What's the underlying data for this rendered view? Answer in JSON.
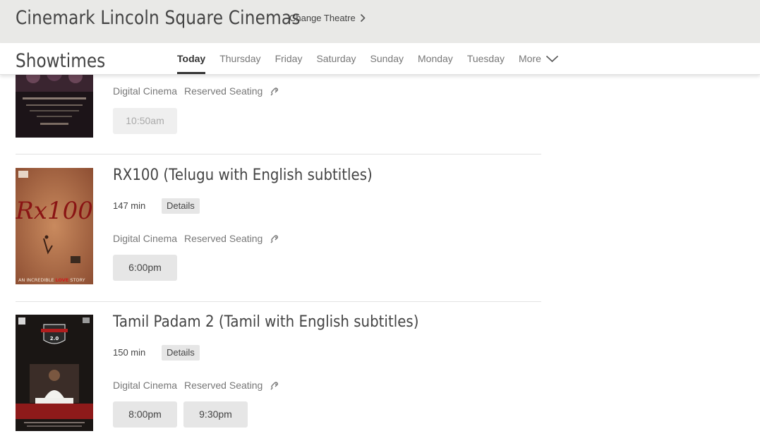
{
  "header": {
    "theatre_name": "Cinemark Lincoln Square Cinemas",
    "change_theatre_label": "Change Theatre"
  },
  "nav": {
    "title": "Showtimes",
    "tabs": [
      {
        "label": "Today",
        "active": true
      },
      {
        "label": "Thursday",
        "active": false
      },
      {
        "label": "Friday",
        "active": false
      },
      {
        "label": "Saturday",
        "active": false
      },
      {
        "label": "Sunday",
        "active": false
      },
      {
        "label": "Monday",
        "active": false
      },
      {
        "label": "Tuesday",
        "active": false
      }
    ],
    "more_label": "More"
  },
  "movies": [
    {
      "amenities": [
        "Digital Cinema",
        "Reserved Seating"
      ],
      "showtimes": [
        {
          "time": "10:50am",
          "past": true
        }
      ]
    },
    {
      "title": "RX100 (Telugu with English subtitles)",
      "runtime": "147 min",
      "details_label": "Details",
      "poster_text": {
        "logo": "Rx100",
        "tagline_1": "AN INCREDIBLE",
        "tagline_2": "LOVE",
        "tagline_3": "STORY"
      },
      "amenities": [
        "Digital Cinema",
        "Reserved Seating"
      ],
      "showtimes": [
        {
          "time": "6:00pm",
          "past": false
        }
      ]
    },
    {
      "title": "Tamil Padam 2 (Tamil with English subtitles)",
      "runtime": "150 min",
      "details_label": "Details",
      "poster_text": {
        "logo": "2.0"
      },
      "amenities": [
        "Digital Cinema",
        "Reserved Seating"
      ],
      "showtimes": [
        {
          "time": "8:00pm",
          "past": false
        },
        {
          "time": "9:30pm",
          "past": false
        }
      ]
    }
  ],
  "colors": {
    "header_bg": "#e9e9e7",
    "text": "#444444",
    "muted_text": "#777777",
    "button_bg": "#e6e6e6",
    "rx100_poster": "#b9714a",
    "tamil_poster": "#1a1614"
  }
}
